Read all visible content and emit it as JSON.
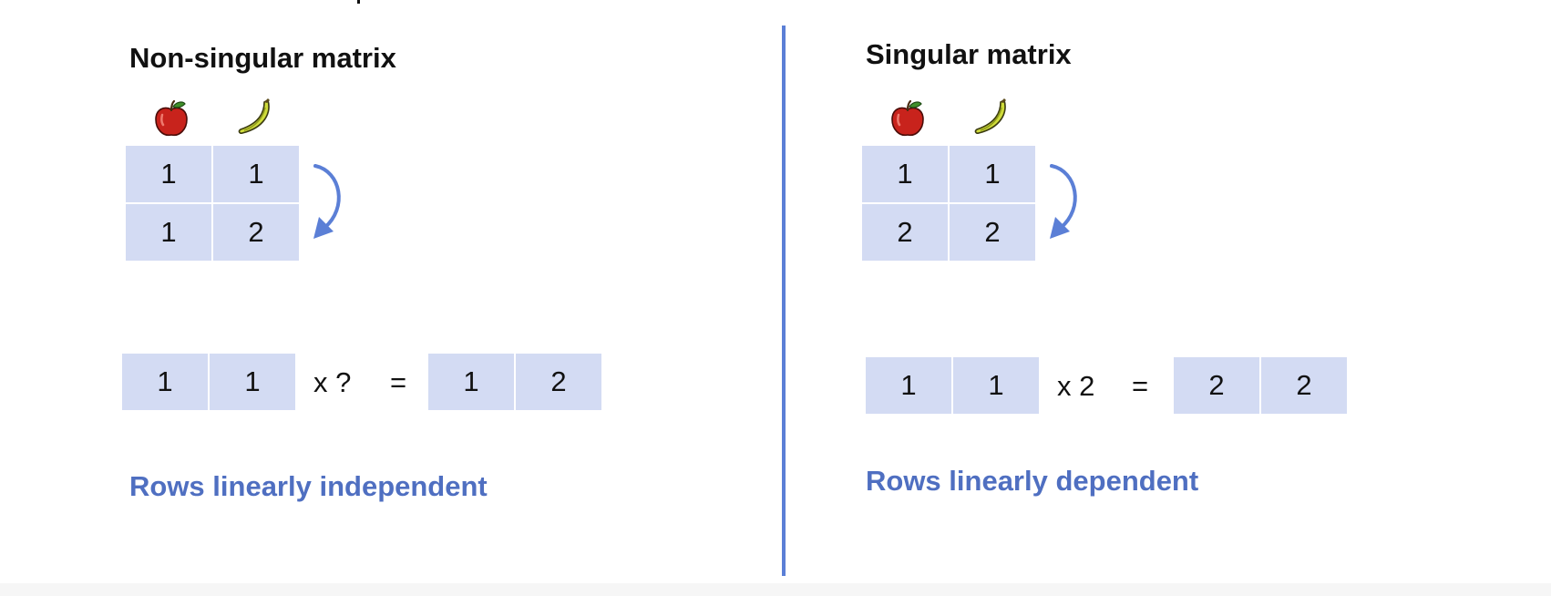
{
  "accent_color": "#5b7fd6",
  "cell_color": "#d3dbf3",
  "note_color": "#4f6fc1",
  "left": {
    "title": "Non-singular matrix",
    "column_icons": [
      "apple-icon",
      "banana-icon"
    ],
    "matrix": [
      [
        "1",
        "1"
      ],
      [
        "1",
        "2"
      ]
    ],
    "equation": {
      "lhs": [
        "1",
        "1"
      ],
      "multiplier": "x ?",
      "equals": "=",
      "rhs": [
        "1",
        "2"
      ]
    },
    "note": "Rows linearly independent"
  },
  "right": {
    "title": "Singular matrix",
    "column_icons": [
      "apple-icon",
      "banana-icon"
    ],
    "matrix": [
      [
        "1",
        "1"
      ],
      [
        "2",
        "2"
      ]
    ],
    "equation": {
      "lhs": [
        "1",
        "1"
      ],
      "multiplier": "x 2",
      "equals": "=",
      "rhs": [
        "2",
        "2"
      ]
    },
    "note": "Rows linearly dependent"
  }
}
